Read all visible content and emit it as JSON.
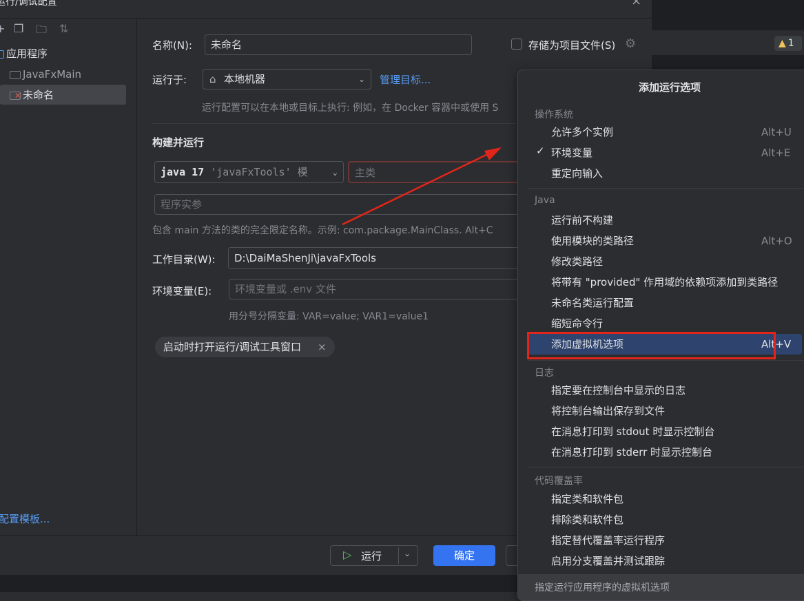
{
  "window": {
    "title": "运行/调试配置",
    "close_glyph": "×"
  },
  "warning_badge": {
    "icon": "warning-triangle-icon",
    "count": "1"
  },
  "left_toolbar": {
    "icons": [
      "add-icon",
      "copy-icon",
      "new-folder-icon",
      "sort-icon"
    ]
  },
  "tree": {
    "root_label": "应用程序",
    "items": [
      {
        "label": "JavaFxMain",
        "selected": false
      },
      {
        "label": "未命名",
        "selected": true
      }
    ],
    "edit_templates_link": "配置模板..."
  },
  "form": {
    "name_label": "名称(N):",
    "name_value": "未命名",
    "store_as_project_label": "存储为项目文件(S)",
    "run_on_label": "运行于:",
    "run_on_value": "本地机器",
    "manage_targets_link": "管理目标...",
    "run_on_hint": "运行配置可以在本地或目标上执行: 例如，在 Docker 容器中或使用 S",
    "build_run_heading": "构建并运行",
    "jdk_value": "java 17",
    "jdk_module": "'javaFxTools' 模",
    "main_class_placeholder": "主类",
    "program_args_placeholder": "程序实参",
    "main_class_hint": "包含 main 方法的类的完全限定名称。示例: com.package.MainClass. Alt+C",
    "workdir_label": "工作目录(W):",
    "workdir_value": "D:\\DaiMaShenJi\\javaFxTools",
    "env_label": "环境变量(E):",
    "env_placeholder": "环境变量或 .env 文件",
    "env_hint": "用分号分隔变量: VAR=value; VAR1=value1",
    "tag_label": "启动时打开运行/调试工具窗口",
    "tag_close": "×"
  },
  "footer_buttons": {
    "run_label": "运行",
    "ok_label": "确定"
  },
  "popup": {
    "title": "添加运行选项",
    "sections": [
      {
        "name": "操作系统",
        "items": [
          {
            "label": "允许多个实例",
            "shortcut": "Alt+U",
            "checked": false
          },
          {
            "label": "环境变量",
            "shortcut": "Alt+E",
            "checked": true
          },
          {
            "label": "重定向输入",
            "shortcut": "",
            "checked": false
          }
        ]
      },
      {
        "name": "Java",
        "items": [
          {
            "label": "运行前不构建",
            "shortcut": "",
            "checked": false
          },
          {
            "label": "使用模块的类路径",
            "shortcut": "Alt+O",
            "checked": false
          },
          {
            "label": "修改类路径",
            "shortcut": "",
            "checked": false
          },
          {
            "label": "将带有 \"provided\" 作用域的依赖项添加到类路径",
            "shortcut": "",
            "checked": false
          },
          {
            "label": "未命名类运行配置",
            "shortcut": "",
            "checked": false
          },
          {
            "label": "缩短命令行",
            "shortcut": "",
            "checked": false
          },
          {
            "label": "添加虚拟机选项",
            "shortcut": "Alt+V",
            "checked": false,
            "highlighted": true
          }
        ]
      },
      {
        "name": "日志",
        "items": [
          {
            "label": "指定要在控制台中显示的日志",
            "shortcut": ""
          },
          {
            "label": "将控制台输出保存到文件",
            "shortcut": ""
          },
          {
            "label": "在消息打印到 stdout 时显示控制台",
            "shortcut": ""
          },
          {
            "label": "在消息打印到 stderr 时显示控制台",
            "shortcut": ""
          }
        ]
      },
      {
        "name": "代码覆盖率",
        "items": [
          {
            "label": "指定类和软件包",
            "shortcut": ""
          },
          {
            "label": "排除类和软件包",
            "shortcut": ""
          },
          {
            "label": "指定替代覆盖率运行程序",
            "shortcut": ""
          },
          {
            "label": "启用分支覆盖并测试跟踪",
            "shortcut": ""
          }
        ]
      }
    ],
    "footer_hint": "指定运行应用程序的虚拟机选项"
  },
  "colors": {
    "background": "#2b2d30",
    "accent": "#3574f0",
    "link": "#589df6",
    "highlight": "#2e436e",
    "annotation_red": "#e1251b"
  }
}
